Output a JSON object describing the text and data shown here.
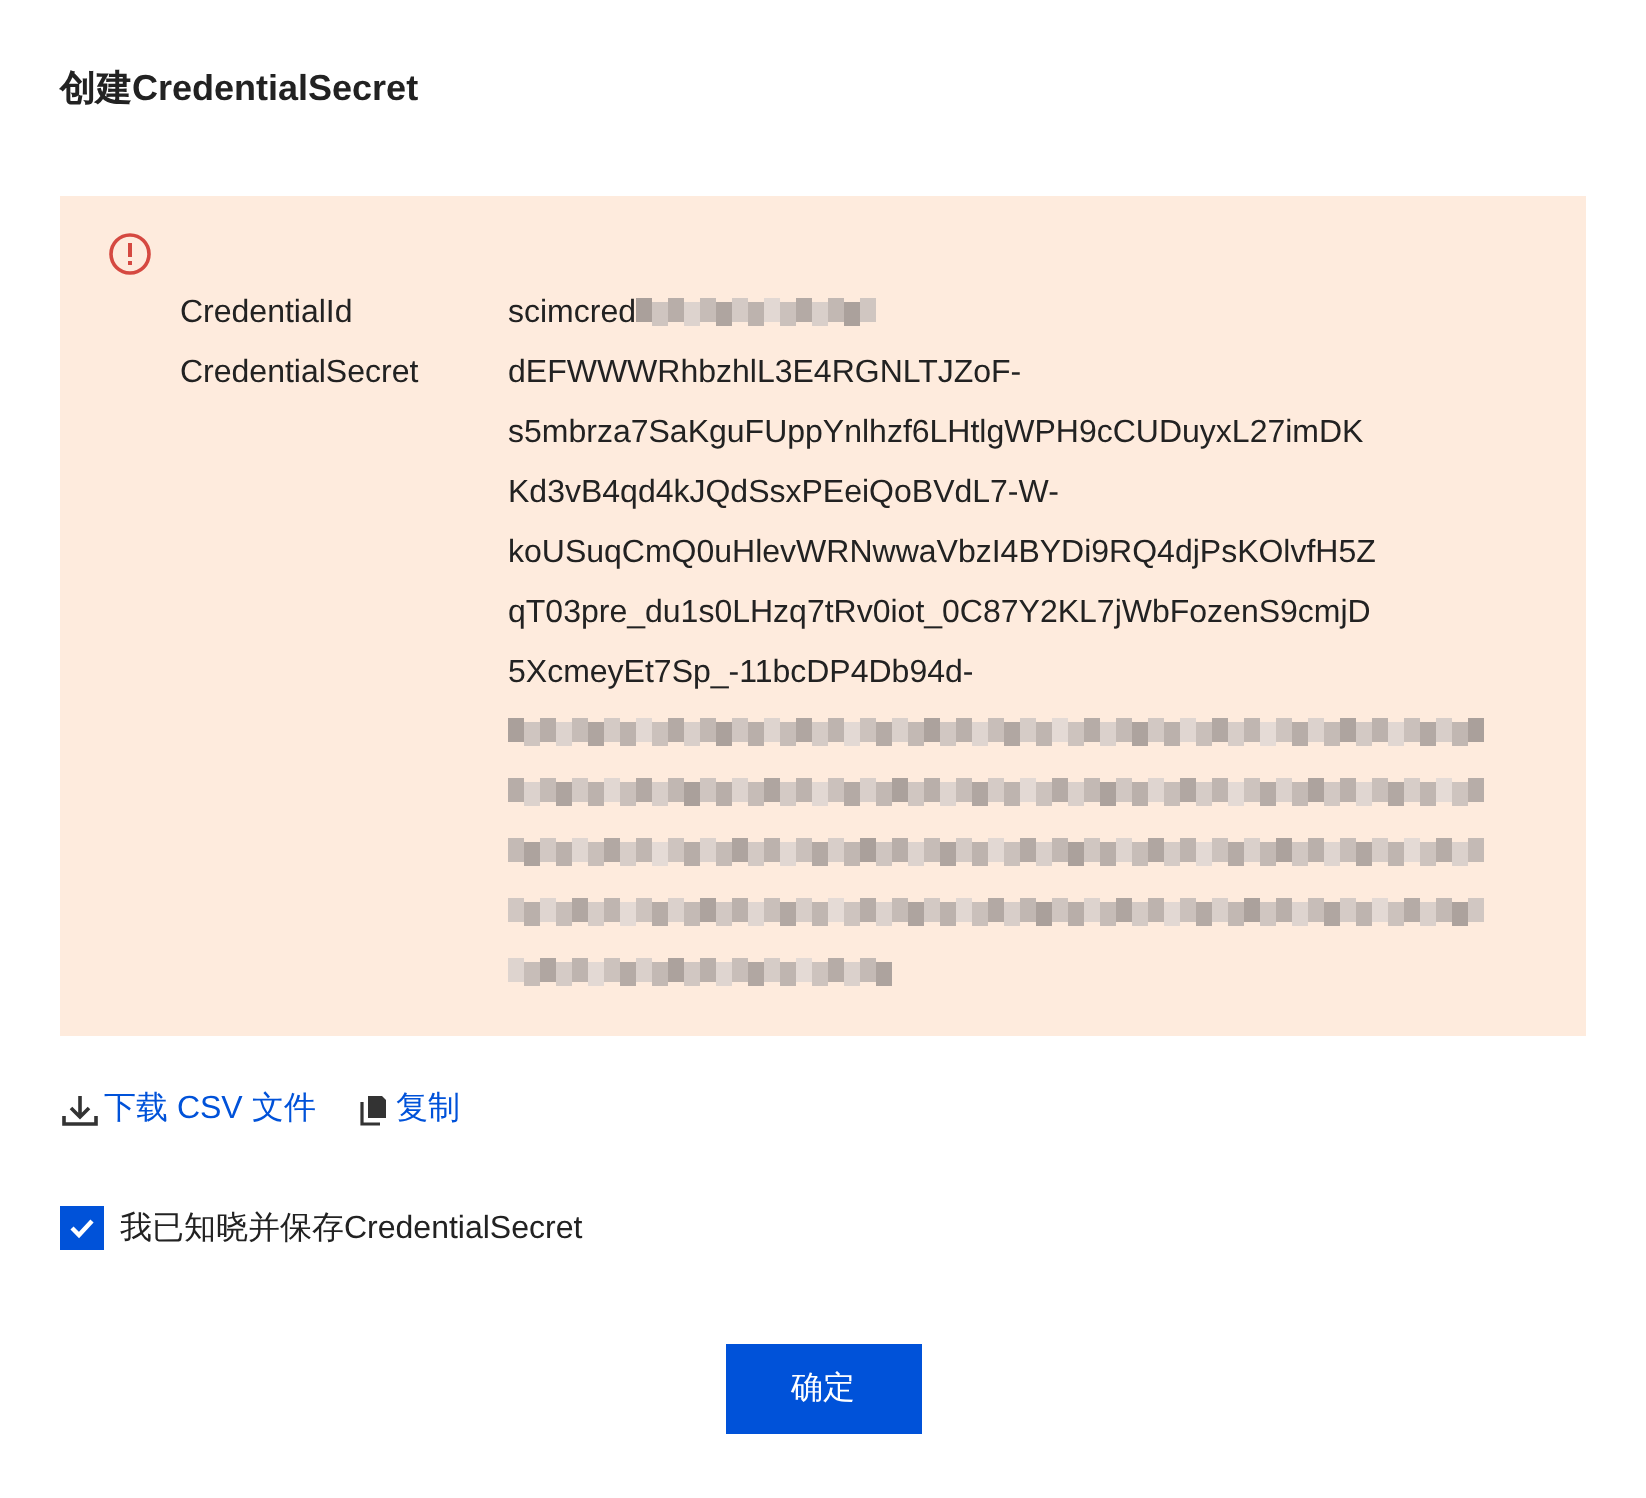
{
  "title": "创建CredentialSecret",
  "notice": {
    "fields": [
      {
        "label": "CredentialId",
        "kind": "inline",
        "lines": [
          "scimcred"
        ]
      },
      {
        "label": "CredentialSecret",
        "lines": [
          "dEFWWWRhbzhlL3E4RGNLTJZoF-",
          "s5mbrza7SaKguFUppYnlhzf6LHtlgWPH9cCUDuyxL27imDK",
          "Kd3vB4qd4kJQdSsxPEeiQoBVdL7-W-",
          "koUSuqCmQ0uHlevWRNwwaVbzI4BYDi9RQ4djPsKOlvfH5Z",
          "qT03pre_du1s0LHzq7tRv0iot_0C87Y2KL7jWbFozenS9cmjD",
          "5XcmeyEt7Sp_-11bcDP4Db94d-"
        ],
        "kind": "block"
      }
    ]
  },
  "actions": [
    {
      "kind": "download",
      "label": "下载 CSV 文件"
    },
    {
      "kind": "copy",
      "label": "复制"
    }
  ],
  "acknowledge": {
    "label": "我已知晓并保存CredentialSecret",
    "checked": true
  },
  "confirm_button": "确定"
}
